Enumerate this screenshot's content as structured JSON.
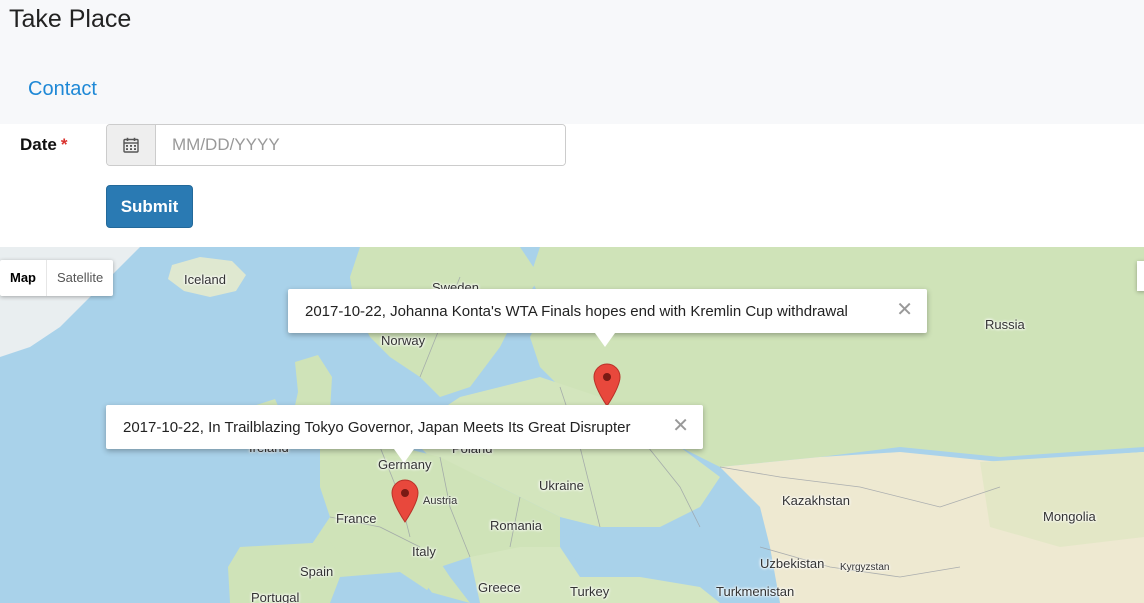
{
  "app": {
    "title": "Take Place"
  },
  "nav": {
    "contact": "Contact"
  },
  "form": {
    "date_label": "Date",
    "required_mark": "*",
    "date_placeholder": "MM/DD/YYYY",
    "submit_label": "Submit"
  },
  "map": {
    "type_map": "Map",
    "type_satellite": "Satellite",
    "labels": {
      "iceland": "Iceland",
      "sweden": "Sweden",
      "norway": "Norway",
      "russia": "Russia",
      "ireland": "Ireland",
      "germany": "Germany",
      "poland": "Poland",
      "ukraine": "Ukraine",
      "france": "France",
      "austria": "Austria",
      "romania": "Romania",
      "italy": "Italy",
      "spain": "Spain",
      "portugal": "Portugal",
      "greece": "Greece",
      "turkey": "Turkey",
      "kazakhstan": "Kazakhstan",
      "mongolia": "Mongolia",
      "uzbekistan": "Uzbekistan",
      "kyrgyzstan": "Kyrgyzstan",
      "turkmenistan": "Turkmenistan"
    },
    "info_windows": [
      {
        "text": "2017-10-22, Johanna Konta's WTA Finals hopes end with Kremlin Cup withdrawal",
        "close": "✕"
      },
      {
        "text": "2017-10-22, In Trailblazing Tokyo Governor, Japan Meets Its Great Disrupter",
        "close": "✕"
      }
    ]
  },
  "colors": {
    "link": "#1e88d6",
    "submit": "#2a7ab3",
    "required": "#d9302c",
    "water": "#a9d2ea",
    "land": "#cfe3b8",
    "desert": "#eee9d1",
    "marker": "#e8483c"
  }
}
